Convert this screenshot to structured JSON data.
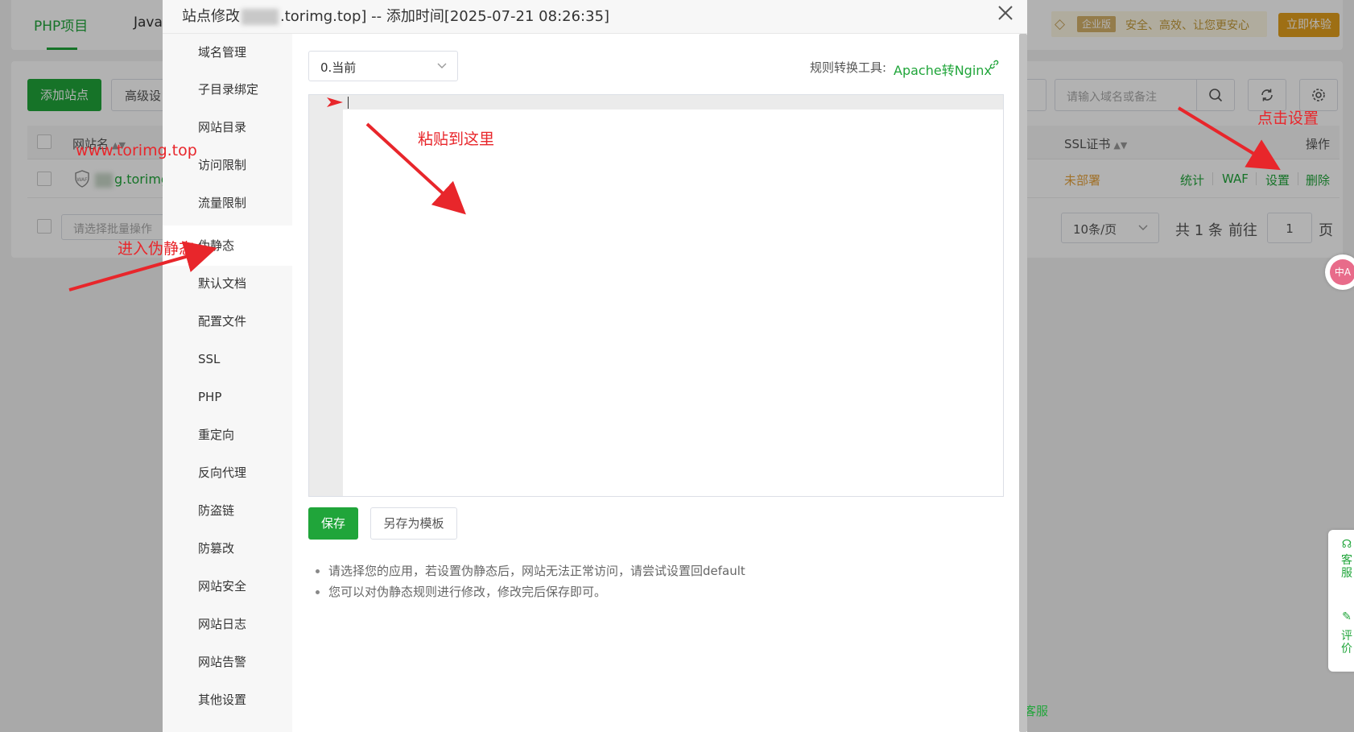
{
  "background": {
    "top_tabs": [
      "PHP项目",
      "Java"
    ],
    "vip": {
      "badge": "企业版",
      "slogan": "安全、高效、让您更安心",
      "trial_button": "立即体验"
    },
    "toolbar": {
      "add_site": "添加站点",
      "advanced": "高级设",
      "search_placeholder": "请输入域名或备注"
    },
    "table": {
      "headers": {
        "site_name": "网站名",
        "ssl": "SSL证书",
        "actions": "操作"
      },
      "row": {
        "site_name": "g.torimg.",
        "ssl_status": "未部署",
        "actions": [
          "统计",
          "WAF",
          "设置",
          "删除"
        ]
      }
    },
    "pager": {
      "batch_placeholder": "请选择批量操作",
      "page_size": "10条/页",
      "total": "共 1 条",
      "goto": "前往",
      "page_value": "1",
      "page_unit": "页"
    },
    "side_float": {
      "service": "客服",
      "review": "评价"
    },
    "translate_label": "中A",
    "bottom_service": "客服"
  },
  "modal": {
    "title": {
      "prefix": "站点修改",
      "suffix": ".torimg.top] -- 添加时间[2025-07-21 08:26:35]"
    },
    "nav": [
      "域名管理",
      "子目录绑定",
      "网站目录",
      "访问限制",
      "流量限制",
      "伪静态",
      "默认文档",
      "配置文件",
      "SSL",
      "PHP",
      "重定向",
      "反向代理",
      "防盗链",
      "防篡改",
      "网站安全",
      "网站日志",
      "网站告警",
      "其他设置"
    ],
    "active_nav": "伪静态",
    "version_select": "0.当前",
    "converter": {
      "label": "规则转换工具:",
      "link": "Apache转Nginx"
    },
    "buttons": {
      "save": "保存",
      "save_as_template": "另存为模板"
    },
    "tips": [
      "请选择您的应用，若设置伪静态后，网站无法正常访问，请尝试设置回default",
      "您可以对伪静态规则进行修改，修改完后保存即可。"
    ]
  },
  "annotations": {
    "domain": "www.torimg.top",
    "enter_rewrite": "进入伪静态",
    "paste_here": "粘贴到这里",
    "click_settings": "点击设置"
  },
  "colors": {
    "accent": "#20a53a",
    "annotation": "#e8262b",
    "warning": "#e6a23c",
    "vip_gold": "#c39a38"
  }
}
